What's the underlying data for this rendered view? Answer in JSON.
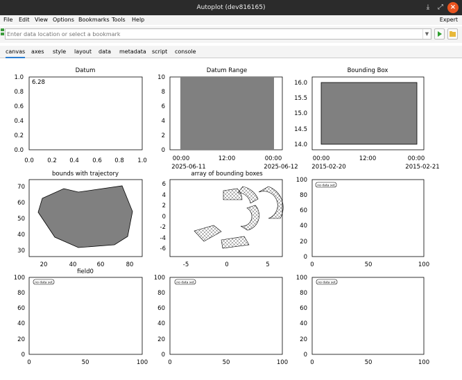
{
  "window": {
    "title": "Autoplot (dev816165)"
  },
  "menu": {
    "items": [
      "File",
      "Edit",
      "View",
      "Options",
      "Bookmarks",
      "Tools",
      "Help"
    ],
    "expert": "Expert"
  },
  "location": {
    "placeholder": "Enter data location or select a bookmark",
    "value": ""
  },
  "tabs": [
    "canvas",
    "axes",
    "style",
    "layout",
    "data",
    "metadata",
    "script",
    "console"
  ],
  "active_tab": "canvas",
  "plots": {
    "p1_title": "Datum",
    "p1_value": "6.28",
    "p2_title": "Datum Range",
    "p3_title": "Bounding Box",
    "p4_title": "bounds with trajectory",
    "p5_title": "array of bounding boxes",
    "p7_title": "field0",
    "no_data": "no data set"
  },
  "axis_labels": {
    "y_0_1": [
      "1.0",
      "0.8",
      "0.6",
      "0.4",
      "0.2",
      "0.0"
    ],
    "x_0_1": [
      "0.0",
      "0.2",
      "0.4",
      "0.6",
      "0.8",
      "1.0"
    ],
    "y_0_10": [
      "10",
      "8",
      "6",
      "4",
      "2",
      "0"
    ],
    "x_time1": [
      "00:00",
      "12:00",
      "00:00"
    ],
    "x_time1_dates": [
      "2025-06-11",
      "2025-06-12"
    ],
    "y_bbox": [
      "16.0",
      "15.5",
      "15.0",
      "14.5",
      "14.0"
    ],
    "x_time2": [
      "00:00",
      "12:00",
      "00:00"
    ],
    "x_time2_dates": [
      "2015-02-20",
      "2015-02-21"
    ],
    "y_traj": [
      "70",
      "60",
      "50",
      "40",
      "30"
    ],
    "x_traj": [
      "20",
      "40",
      "60",
      "80"
    ],
    "y_arr": [
      "6",
      "4",
      "2",
      "0",
      "-2",
      "-4",
      "-6"
    ],
    "x_arr": [
      "-5",
      "0",
      "5"
    ],
    "y_100": [
      "100",
      "80",
      "60",
      "40",
      "20",
      "0"
    ],
    "x_100": [
      "0",
      "50",
      "100"
    ]
  },
  "chart_data": [
    {
      "type": "scatter",
      "title": "Datum",
      "value": 6.28,
      "xlim": [
        0,
        1
      ],
      "ylim": [
        0,
        1
      ]
    },
    {
      "type": "area",
      "title": "Datum Range",
      "x": [
        "2025-06-11 00:00",
        "2025-06-12 00:00"
      ],
      "y": [
        0,
        10
      ],
      "ylim": [
        0,
        10
      ]
    },
    {
      "type": "area",
      "title": "Bounding Box",
      "x": [
        "2015-02-20 00:00",
        "2015-02-21 00:00"
      ],
      "y": [
        14.0,
        16.0
      ],
      "ylim": [
        13.8,
        16.2
      ]
    },
    {
      "type": "area",
      "title": "bounds with trajectory",
      "x": [
        18,
        33,
        47,
        76,
        83,
        77,
        69,
        45,
        25,
        14
      ],
      "y": [
        63,
        69,
        67,
        72,
        55,
        37,
        33,
        32,
        39,
        55
      ],
      "xlim": [
        10,
        87
      ],
      "ylim": [
        28,
        74
      ]
    },
    {
      "type": "area",
      "title": "array of bounding boxes",
      "xlim": [
        -7,
        7
      ],
      "ylim": [
        -7,
        7
      ]
    },
    {
      "type": "scatter",
      "title": "",
      "xlim": [
        0,
        100
      ],
      "ylim": [
        0,
        100
      ]
    },
    {
      "type": "scatter",
      "title": "field0",
      "xlim": [
        0,
        100
      ],
      "ylim": [
        0,
        100
      ]
    },
    {
      "type": "scatter",
      "title": "",
      "xlim": [
        0,
        100
      ],
      "ylim": [
        0,
        100
      ]
    },
    {
      "type": "scatter",
      "title": "",
      "xlim": [
        0,
        100
      ],
      "ylim": [
        0,
        100
      ]
    }
  ]
}
